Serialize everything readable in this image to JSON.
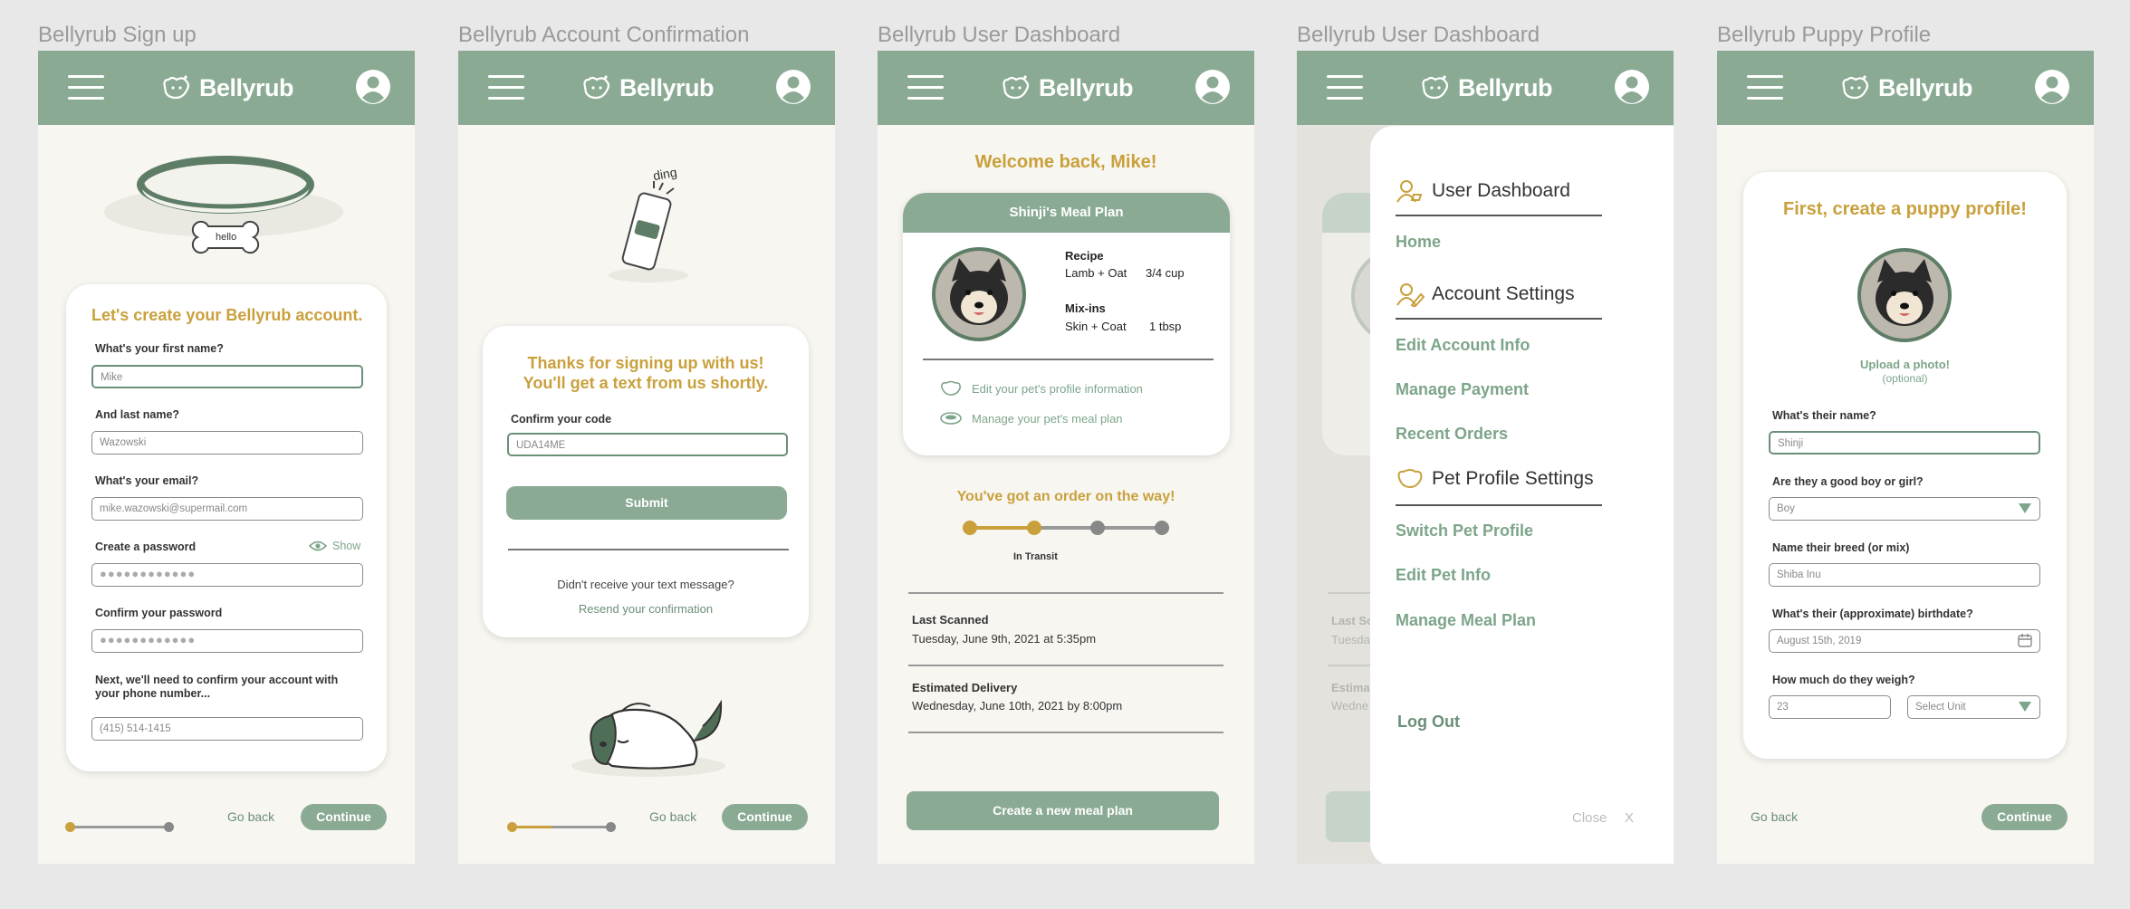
{
  "app": {
    "name": "Bellyrub",
    "accent": "#8aaa94",
    "gold": "#c9a03c"
  },
  "frames": {
    "signup": "Bellyrub Sign up",
    "confirm": "Bellyrub Account Confirmation",
    "dashboard": "Bellyrub User Dashboard",
    "menu": "Bellyrub User Dashboard",
    "puppy": "Bellyrub Puppy Profile"
  },
  "signup": {
    "collar_tag": "hello",
    "heading": "Let's create your Bellyrub account.",
    "first_name_label": "What's your first name?",
    "first_name_value": "Mike",
    "last_name_label": "And last name?",
    "last_name_value": "Wazowski",
    "email_label": "What's your email?",
    "email_value": "mike.wazowski@supermail.com",
    "password_label": "Create a password",
    "show_label": "Show",
    "password_value": "●●●●●●●●●●●●",
    "confirm_password_label": "Confirm your password",
    "confirm_password_value": "●●●●●●●●●●●●",
    "phone_label": "Next, we'll need to confirm your account with your phone number...",
    "phone_value": "(415) 514-1415",
    "go_back": "Go back",
    "continue": "Continue",
    "progress": 0.0
  },
  "confirm": {
    "ding": "ding",
    "heading_line1": "Thanks for signing up with us!",
    "heading_line2": "You'll get a text from us shortly.",
    "code_label": "Confirm your code",
    "code_value": "UDA14ME",
    "submit": "Submit",
    "no_text": "Didn't receive your text message?",
    "resend": "Resend your confirmation",
    "go_back": "Go back",
    "continue": "Continue",
    "progress": 0.4
  },
  "dashboard": {
    "welcome": "Welcome back, Mike!",
    "meal_plan_title": "Shinji's Meal Plan",
    "recipe_label": "Recipe",
    "recipe_name": "Lamb + Oat",
    "recipe_qty": "3/4 cup",
    "mixins_label": "Mix-ins",
    "mixins_name": "Skin + Coat",
    "mixins_qty": "1 tbsp",
    "edit_profile": "Edit your pet's profile information",
    "manage_plan": "Manage your pet's meal plan",
    "order_heading": "You've got an order on the way!",
    "order_status": "In Transit",
    "order_steps_done": 2,
    "order_steps_total": 4,
    "last_scanned_label": "Last Scanned",
    "last_scanned_value": "Tuesday, June 9th, 2021 at 5:35pm",
    "est_delivery_label": "Estimated Delivery",
    "est_delivery_value": "Wednesday, June 10th, 2021 by 8:00pm",
    "create_plan": "Create a new meal plan"
  },
  "menu": {
    "bg_last": "Last Sc",
    "bg_tues": "Tuesda",
    "bg_estima": "Estima",
    "bg_wedne": "Wedne",
    "user_dashboard": "User Dashboard",
    "home": "Home",
    "account_settings": "Account Settings",
    "edit_account": "Edit Account Info",
    "manage_payment": "Manage Payment",
    "recent_orders": "Recent Orders",
    "pet_settings": "Pet Profile Settings",
    "switch_pet": "Switch Pet Profile",
    "edit_pet": "Edit Pet Info",
    "manage_meal": "Manage Meal Plan",
    "log_out": "Log Out",
    "close": "Close",
    "close_x": "X"
  },
  "puppy": {
    "heading": "First, create a puppy profile!",
    "upload": "Upload a photo!",
    "optional": "(optional)",
    "name_label": "What's their name?",
    "name_value": "Shinji",
    "gender_label": "Are they a good boy or girl?",
    "gender_value": "Boy",
    "breed_label": "Name their breed (or mix)",
    "breed_value": "Shiba Inu",
    "birthdate_label": "What's their (approximate) birthdate?",
    "birthdate_value": "August 15th, 2019",
    "weight_label": "How much do they weigh?",
    "weight_value": "23",
    "unit_placeholder": "Select Unit",
    "go_back": "Go back",
    "continue": "Continue"
  }
}
